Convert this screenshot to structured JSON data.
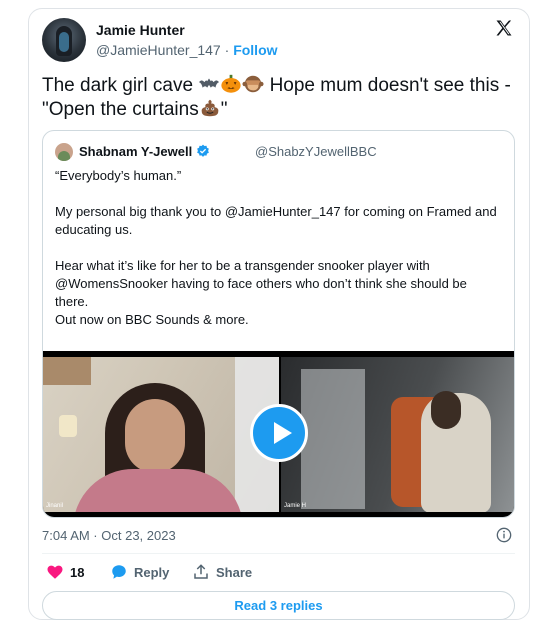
{
  "author": {
    "name": "Jamie Hunter",
    "handle": "@JamieHunter_147",
    "separator": " · ",
    "follow_label": "Follow"
  },
  "tweet": {
    "text_before": "The dark girl cave ",
    "text_mid": " Hope mum doesn't see this - \"Open the curtains",
    "text_after": "\"",
    "emojis": [
      "bat-emoji",
      "jack-o-lantern-emoji",
      "see-no-evil-monkey-emoji",
      "pile-of-poo-emoji"
    ],
    "timestamp": "7:04 AM · Oct 23, 2023"
  },
  "quote": {
    "name": "Shabnam Y-Jewell",
    "handle": "@ShabzYJewellBBC",
    "line1": "“Everybody’s human.”",
    "line2": "My personal big thank you to @JamieHunter_147 for coming on Framed and educating us.",
    "line3": "Hear what it’s like for her to be a transgender snooker player with @WomensSnooker having to face others who don’t think she should be there.",
    "line4": "Out now on BBC Sounds & more.",
    "video": {
      "left_tag": "Jinanil",
      "right_tag": "Jamie H"
    }
  },
  "actions": {
    "likes": "18",
    "reply_label": "Reply",
    "share_label": "Share"
  },
  "read_replies_label": "Read 3 replies",
  "colors": {
    "accent": "#1d9bf0",
    "like": "#f91880",
    "muted": "#536471"
  }
}
